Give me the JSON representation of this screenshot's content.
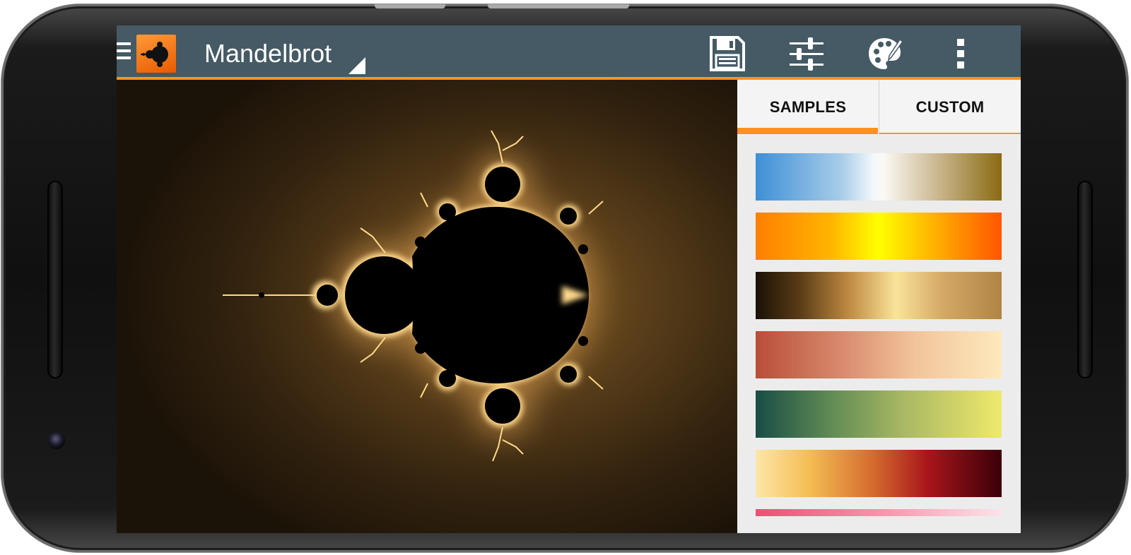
{
  "appbar": {
    "title": "Mandelbrot",
    "actions": [
      {
        "icon": "save-icon"
      },
      {
        "icon": "tune-icon"
      },
      {
        "icon": "palette-icon"
      },
      {
        "icon": "more-vert-icon"
      }
    ]
  },
  "panel": {
    "tabs": [
      {
        "label": "SAMPLES",
        "selected": true
      },
      {
        "label": "CUSTOM",
        "selected": false
      }
    ],
    "gradients": [
      [
        "#3e8fd6",
        "#f4f8fb",
        "#8a6a12"
      ],
      [
        "#ff7f00",
        "#ffff00",
        "#ff5500"
      ],
      [
        "#1a1106",
        "#fae49a",
        "#b08445"
      ],
      [
        "#b94e3a",
        "#f2c59c",
        "#fde9bc"
      ],
      [
        "#184d45",
        "#a9b863",
        "#f0e96c"
      ],
      [
        "#fde6a8",
        "#a8151b",
        "#3a0008"
      ],
      [
        "#ee4e73",
        "#fde3ea"
      ]
    ]
  },
  "colors": {
    "appbar": "#455a64",
    "accent": "#f7941d",
    "fractal_glow": "#f0c070",
    "fractal_background": "#2a1d0d"
  }
}
